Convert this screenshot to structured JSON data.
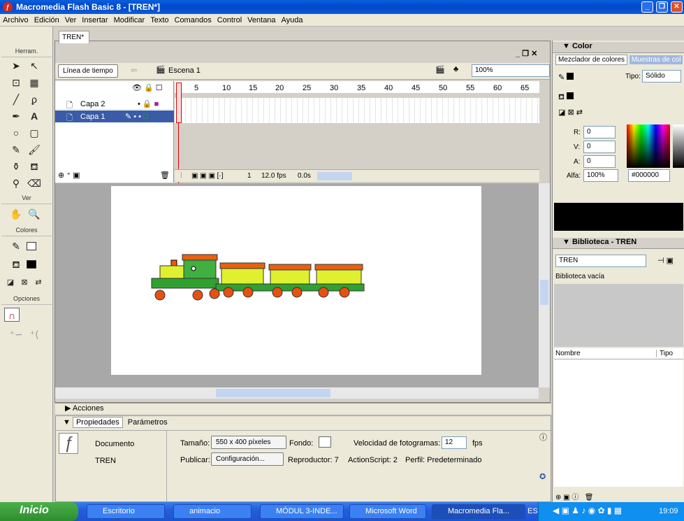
{
  "window": {
    "title": "Macromedia Flash Basic 8 - [TREN*]"
  },
  "menu": [
    "Archivo",
    "Edición",
    "Ver",
    "Insertar",
    "Modificar",
    "Texto",
    "Comandos",
    "Control",
    "Ventana",
    "Ayuda"
  ],
  "tools": {
    "header": "Herram.",
    "view_header": "Ver",
    "colors_header": "Colores",
    "options_header": "Opciones"
  },
  "document": {
    "tab": "TREN*",
    "timeline_button": "Línea de tiempo",
    "scene": "Escena 1",
    "zoom": "100%",
    "frame_numbers": [
      "5",
      "10",
      "15",
      "20",
      "25",
      "30",
      "35",
      "40",
      "45",
      "50",
      "55",
      "60",
      "65"
    ],
    "layers": [
      {
        "name": "Capa 2"
      },
      {
        "name": "Capa 1"
      }
    ],
    "status": {
      "frame": "1",
      "fps": "12.0 fps",
      "time": "0.0s"
    }
  },
  "actions_panel": {
    "label": "Acciones"
  },
  "properties": {
    "tab1": "Propiedades",
    "tab2": "Parámetros",
    "doc_label": "Documento",
    "doc_name": "TREN",
    "size_label": "Tamaño:",
    "size_value": "550 x 400 píxeles",
    "bg_label": "Fondo:",
    "fps_label": "Velocidad de fotogramas:",
    "fps_value": "12",
    "fps_unit": "fps",
    "publish_label": "Publicar:",
    "publish_btn": "Configuración...",
    "player": "Reproductor: 7",
    "actionscript": "ActionScript: 2",
    "profile": "Perfil: Predeterminado"
  },
  "color_panel": {
    "title": "Color",
    "tab1": "Mezclador de colores",
    "tab2": "Muestras de col",
    "type_label": "Tipo:",
    "type_value": "Sólido",
    "r_label": "R:",
    "r_value": "0",
    "g_label": "V:",
    "g_value": "0",
    "b_label": "A:",
    "b_value": "0",
    "alpha_label": "Alfa:",
    "alpha_value": "100%",
    "hex": "#000000"
  },
  "library_panel": {
    "title": "Biblioteca - TREN",
    "selected": "TREN",
    "empty": "Biblioteca vacía",
    "col_name": "Nombre",
    "col_type": "Tipo"
  },
  "taskbar": {
    "start": "Inicio",
    "tasks": [
      "Escritorio",
      "animacio",
      "MÓDUL 3-INDE...",
      "Microsoft Word",
      "Macromedia Fla..."
    ],
    "lang": "ES",
    "clock": "19:09"
  },
  "colors": {
    "accent": "#0a5fdc",
    "stage": "#ffffff"
  }
}
